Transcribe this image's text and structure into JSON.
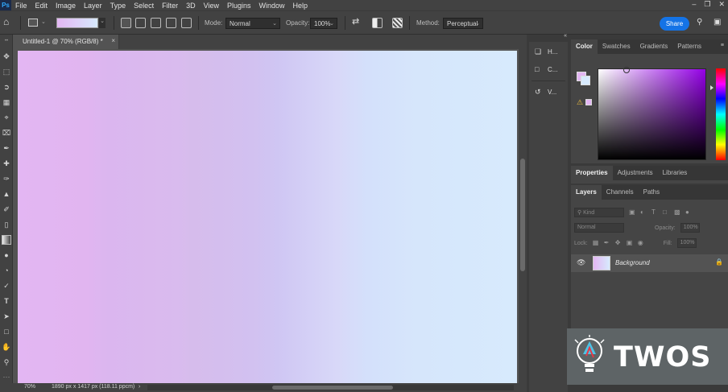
{
  "menubar": {
    "logo": "Ps",
    "items": [
      "File",
      "Edit",
      "Image",
      "Layer",
      "Type",
      "Select",
      "Filter",
      "3D",
      "View",
      "Plugins",
      "Window",
      "Help"
    ]
  },
  "options": {
    "mode_label": "Mode:",
    "mode_value": "Normal",
    "opacity_label": "Opacity:",
    "opacity_value": "100%",
    "method_label": "Method:",
    "method_value": "Perceptual",
    "share_label": "Share"
  },
  "document": {
    "tab_title": "Untitled-1 @ 70% (RGB/8) *",
    "zoom": "70%",
    "size_info": "1890 px x 1417 px (118.11 ppcm)"
  },
  "midpanel": [
    {
      "icon": "history-brush-icon",
      "label": "H..."
    },
    {
      "icon": "comments-icon",
      "label": "C..."
    },
    {
      "icon": "version-history-icon",
      "label": "V..."
    }
  ],
  "color_panel": {
    "tabs": [
      "Color",
      "Swatches",
      "Gradients",
      "Patterns"
    ],
    "foreground": "#e3b6f3",
    "background": "#d7eafd"
  },
  "properties_panel": {
    "tabs": [
      "Properties",
      "Adjustments",
      "Libraries"
    ]
  },
  "layers_panel": {
    "tabs": [
      "Layers",
      "Channels",
      "Paths"
    ],
    "filter_placeholder": "Kind",
    "blend_mode": "Normal",
    "opacity_label": "Opacity:",
    "opacity_value": "100%",
    "lock_label": "Lock:",
    "fill_label": "Fill:",
    "fill_value": "100%",
    "layers": [
      {
        "name": "Background",
        "visible": true,
        "locked": true
      }
    ]
  },
  "watermark": {
    "text": "TWOS"
  }
}
